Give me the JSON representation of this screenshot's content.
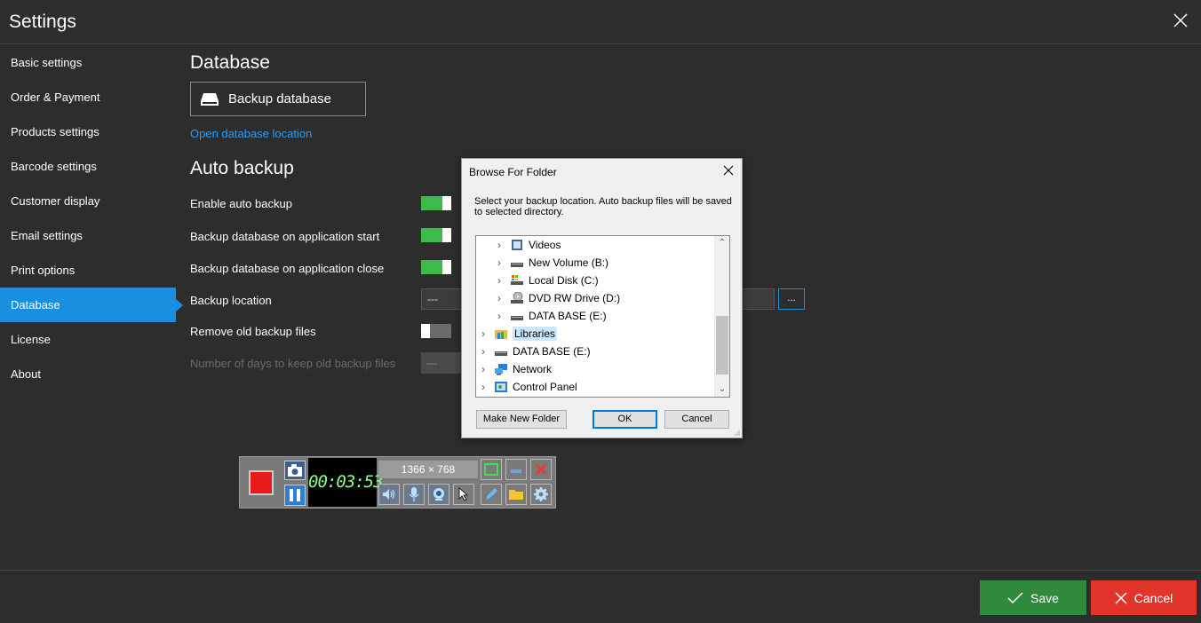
{
  "window": {
    "title": "Settings"
  },
  "sidebar": {
    "items": [
      {
        "label": "Basic settings",
        "active": false
      },
      {
        "label": "Order & Payment",
        "active": false
      },
      {
        "label": "Products settings",
        "active": false
      },
      {
        "label": "Barcode settings",
        "active": false
      },
      {
        "label": "Customer display",
        "active": false
      },
      {
        "label": "Email settings",
        "active": false
      },
      {
        "label": "Print options",
        "active": false
      },
      {
        "label": "Database",
        "active": true
      },
      {
        "label": "License",
        "active": false
      },
      {
        "label": "About",
        "active": false
      }
    ]
  },
  "database": {
    "heading": "Database",
    "backup_button": "Backup database",
    "open_location_link": "Open database location"
  },
  "auto_backup": {
    "heading": "Auto backup",
    "enable_label": "Enable auto backup",
    "enable_on": true,
    "on_start_label": "Backup database on application start",
    "on_start_on": true,
    "on_close_label": "Backup database on application close",
    "on_close_on": true,
    "location_label": "Backup location",
    "location_value": "---",
    "browse_button": "...",
    "remove_old_label": "Remove old backup files",
    "remove_old_on": false,
    "days_label": "Number of days to keep old backup files",
    "days_value": "—"
  },
  "dialog": {
    "title": "Browse For Folder",
    "description": "Select your backup location. Auto backup files will be saved to selected directory.",
    "tree": [
      {
        "label": "Videos",
        "icon": "video-folder-icon",
        "level": 1
      },
      {
        "label": "New Volume (B:)",
        "icon": "drive-icon",
        "level": 1
      },
      {
        "label": "Local Disk (C:)",
        "icon": "system-drive-icon",
        "level": 1
      },
      {
        "label": "DVD RW Drive (D:)",
        "icon": "dvd-drive-icon",
        "level": 1
      },
      {
        "label": "DATA BASE (E:)",
        "icon": "drive-icon",
        "level": 1
      },
      {
        "label": "Libraries",
        "icon": "libraries-icon",
        "level": 0,
        "selected": true
      },
      {
        "label": "DATA BASE (E:)",
        "icon": "drive-icon",
        "level": 0
      },
      {
        "label": "Network",
        "icon": "network-icon",
        "level": 0
      },
      {
        "label": "Control Panel",
        "icon": "control-panel-icon",
        "level": 0
      }
    ],
    "make_new_folder": "Make New Folder",
    "ok": "OK",
    "cancel": "Cancel"
  },
  "recorder": {
    "timer": "00:03:53",
    "resolution": "1366 × 768"
  },
  "footer": {
    "save": "Save",
    "cancel": "Cancel"
  },
  "colors": {
    "accent": "#1a8fdf",
    "toggle_on": "#3fb84c",
    "save": "#2f8a3c",
    "cancel": "#e1352c"
  }
}
